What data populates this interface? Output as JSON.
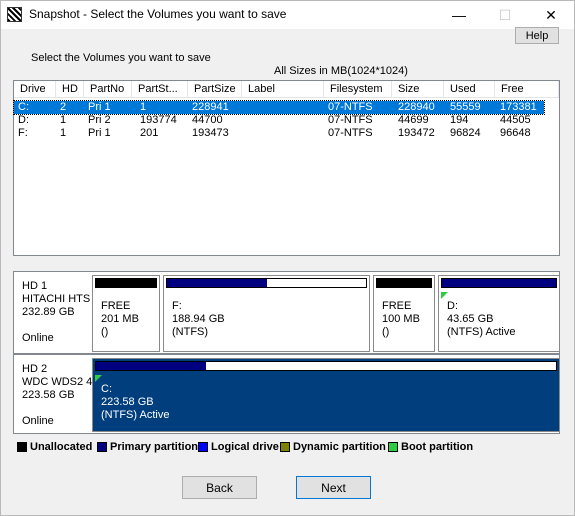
{
  "window": {
    "title": "Snapshot - Select the Volumes you want to save",
    "minimize_glyph": "—",
    "maximize_glyph": "☐",
    "close_glyph": "✕"
  },
  "help_label": "Help",
  "select_label": "Select the Volumes you want to save",
  "sizes_label": "All Sizes in MB(1024*1024)",
  "volumes": {
    "columns": [
      "Drive",
      "HD",
      "PartNo",
      "PartSt...",
      "PartSize",
      "Label",
      "Filesystem",
      "Size",
      "Used",
      "Free"
    ],
    "rows": [
      {
        "drive": "C:",
        "hd": "2",
        "partno": "Pri  1",
        "partst": "1",
        "partsize": "228941",
        "label": "",
        "filesystem": "07-NTFS",
        "size": "228940",
        "used": "55559",
        "free": "173381",
        "selected": true
      },
      {
        "drive": "D:",
        "hd": "1",
        "partno": "Pri  2",
        "partst": "193774",
        "partsize": "44700",
        "label": "",
        "filesystem": "07-NTFS",
        "size": "44699",
        "used": "194",
        "free": "44505",
        "selected": false
      },
      {
        "drive": "F:",
        "hd": "1",
        "partno": "Pri  1",
        "partst": "201",
        "partsize": "193473",
        "label": "",
        "filesystem": "07-NTFS",
        "size": "193472",
        "used": "96824",
        "free": "96648",
        "selected": false
      }
    ]
  },
  "disks": [
    {
      "info": [
        "HD 1",
        "HITACHI HTS",
        "232.89 GB",
        "",
        "Online"
      ],
      "partitions": [
        {
          "lines": [
            "FREE",
            "201 MB",
            "()"
          ],
          "type": "unallocated",
          "used_fraction": 1.0,
          "boot": false,
          "selected": false
        },
        {
          "lines": [
            "F:",
            "188.94 GB",
            "(NTFS)"
          ],
          "type": "primary",
          "used_fraction": 0.5,
          "boot": false,
          "selected": false
        },
        {
          "lines": [
            "FREE",
            "100 MB",
            "()"
          ],
          "type": "unallocated",
          "used_fraction": 1.0,
          "boot": false,
          "selected": false
        },
        {
          "lines": [
            "D:",
            "43.65 GB",
            "(NTFS) Active"
          ],
          "type": "primary",
          "used_fraction": 1.0,
          "boot": true,
          "selected": false
        }
      ]
    },
    {
      "info": [
        "HD 2",
        "WDC WDS2 4",
        "223.58 GB",
        "",
        "Online"
      ],
      "partitions": [
        {
          "lines": [
            "C:",
            "223.58 GB",
            "(NTFS) Active"
          ],
          "type": "primary",
          "used_fraction": 0.24,
          "boot": true,
          "selected": true
        }
      ]
    }
  ],
  "legend": [
    {
      "label": "Unallocated",
      "color": "#000000"
    },
    {
      "label": "Primary partition",
      "color": "#000080"
    },
    {
      "label": "Logical drive",
      "color": "#0000ff"
    },
    {
      "label": "Dynamic partition",
      "color": "#808000"
    },
    {
      "label": "Boot partition",
      "color": "#2ecc40"
    }
  ],
  "buttons": {
    "back": "Back",
    "next": "Next"
  }
}
